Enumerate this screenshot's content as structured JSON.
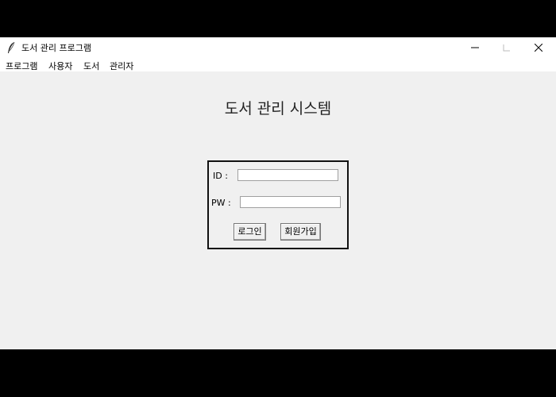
{
  "window": {
    "title": "도서 관리 프로그램",
    "icon": "feather-icon",
    "controls": [
      "minimize-icon",
      "maximize-icon",
      "close-icon"
    ]
  },
  "menubar": {
    "items": [
      {
        "label": "프로그램"
      },
      {
        "label": "사용자"
      },
      {
        "label": "도서"
      },
      {
        "label": "관리자"
      }
    ]
  },
  "main": {
    "heading": "도서 관리 시스템",
    "login": {
      "id_label": "ID :",
      "id_value": "",
      "pw_label": "PW :",
      "pw_value": "",
      "login_button": "로그인",
      "signup_button": "회원가입"
    }
  },
  "colors": {
    "window_bg": "#f0f0f0",
    "titlebar_bg": "#ffffff",
    "box_border": "#111111"
  }
}
